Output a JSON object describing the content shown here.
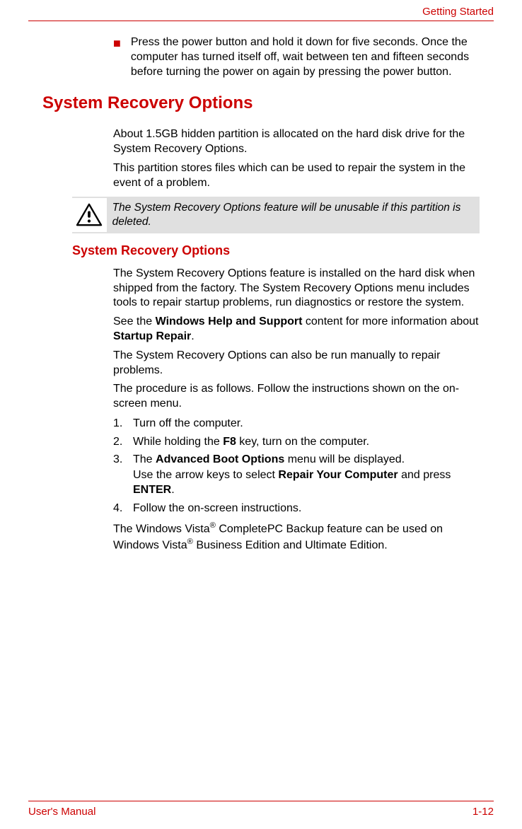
{
  "header": {
    "chapter": "Getting Started"
  },
  "footer": {
    "left": "User's Manual",
    "right": "1-12"
  },
  "bullets": [
    "Press the power button and hold it down for five seconds. Once the computer has turned itself off, wait between ten and fifteen seconds before turning the power on again by pressing the power button."
  ],
  "section1": {
    "title": "System Recovery Options",
    "p1": "About 1.5GB hidden partition is allocated on the hard disk drive for the System Recovery Options.",
    "p2": "This partition stores files which can be used to repair the system in the event of a problem."
  },
  "note": "The System Recovery Options feature will be unusable if this partition is deleted.",
  "section2": {
    "title": "System Recovery Options",
    "p1": "The System Recovery Options feature is installed on the hard disk when shipped from the factory. The System Recovery Options menu includes tools to repair startup problems, run diagnostics or restore the system.",
    "p2_a": "See the ",
    "p2_b": "Windows Help and Support",
    "p2_c": " content for more information about ",
    "p2_d": "Startup Repair",
    "p2_e": ".",
    "p3": "The System Recovery Options can also be run manually to repair problems.",
    "p4": "The procedure is as follows. Follow the instructions shown on the on-screen menu.",
    "steps": {
      "s1": {
        "n": "1.",
        "t": "Turn off the computer."
      },
      "s2": {
        "n": "2.",
        "a": "While holding the ",
        "b": "F8",
        "c": " key, turn on the computer."
      },
      "s3": {
        "n": "3.",
        "a": "The ",
        "b": "Advanced Boot Options",
        "c": " menu will be displayed.",
        "d": "Use the arrow keys to select ",
        "e": "Repair Your Computer",
        "f": " and press ",
        "g": "ENTER",
        "h": "."
      },
      "s4": {
        "n": "4.",
        "t": "Follow the on-screen instructions."
      }
    },
    "p5_a": "The Windows Vista",
    "p5_b": "®",
    "p5_c": " CompletePC Backup feature can be used on Windows Vista",
    "p5_d": "®",
    "p5_e": " Business Edition and Ultimate Edition."
  }
}
